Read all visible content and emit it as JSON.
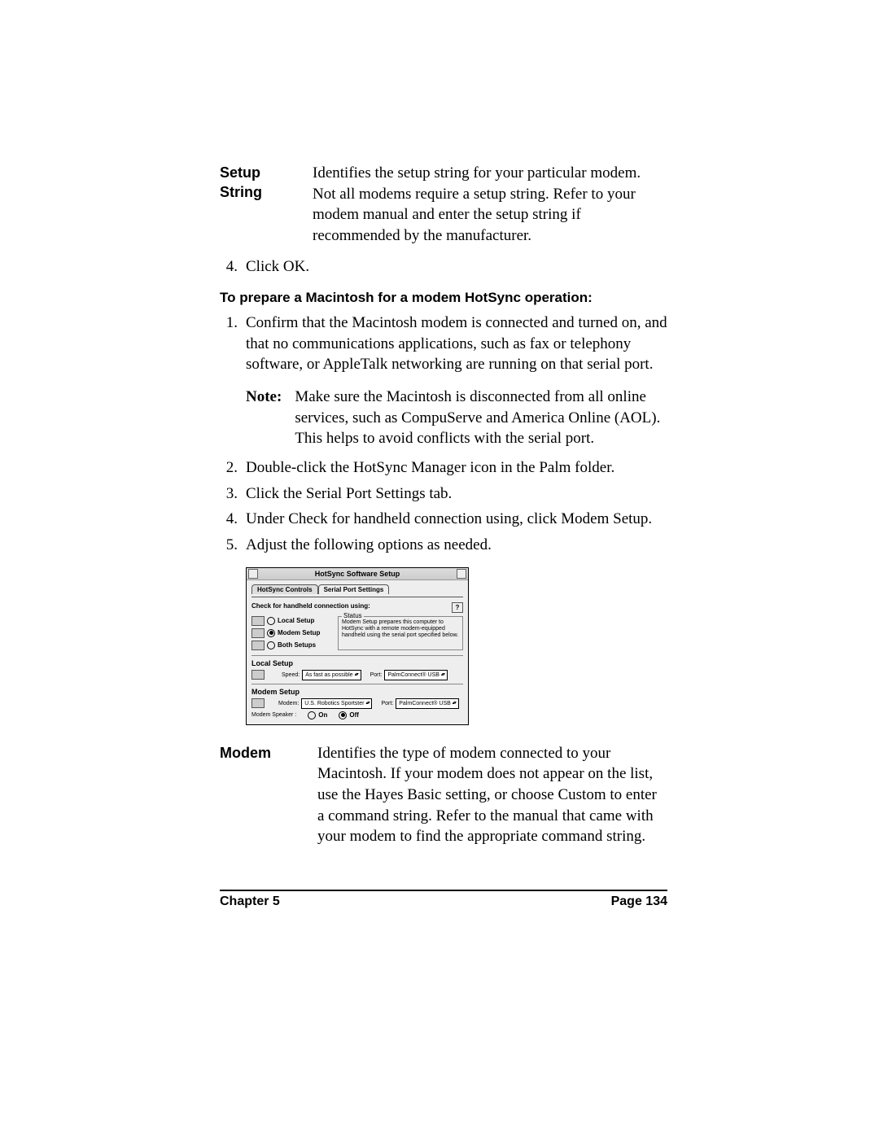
{
  "definitions": {
    "setup_string": {
      "term": "Setup String",
      "body": "Identifies the setup string for your particular modem. Not all modems require a setup string. Refer to your modem manual and enter the setup string if recommended by the manufacturer."
    },
    "modem": {
      "term": "Modem",
      "body": "Identifies the type of modem connected to your Macintosh. If your modem does not appear on the list, use the Hayes Basic setting, or choose Custom to enter a command string. Refer to the manual that came with your modem to find the appropriate command string."
    }
  },
  "step4": {
    "num": "4.",
    "text": "Click OK."
  },
  "subheading": "To prepare a Macintosh for a modem HotSync operation:",
  "steps": [
    {
      "num": "1.",
      "text": "Confirm that the Macintosh modem is connected and turned on, and that no communications applications, such as fax or telephony software, or AppleTalk networking are running on that serial port."
    },
    {
      "num": "2.",
      "text": "Double-click the HotSync Manager icon in the Palm folder."
    },
    {
      "num": "3.",
      "text": "Click the Serial Port Settings tab."
    },
    {
      "num": "4.",
      "text": "Under Check for handheld connection using, click Modem Setup."
    },
    {
      "num": "5.",
      "text": "Adjust the following options as needed."
    }
  ],
  "note": {
    "label": "Note:",
    "body": "Make sure the Macintosh is disconnected from all online services, such as CompuServe and America Online (AOL). This helps to avoid conflicts with the serial port."
  },
  "screenshot": {
    "title": "HotSync Software Setup",
    "tabs": [
      "HotSync Controls",
      "Serial Port Settings"
    ],
    "check_label": "Check for handheld connection using:",
    "help": "?",
    "radios": [
      "Local Setup",
      "Modem Setup",
      "Both Setups"
    ],
    "selected_radio": "Modem Setup",
    "status": {
      "legend": "Status",
      "text": "Modem Setup prepares this computer to HotSync with a remote modem-equipped handheld using the serial port specified below."
    },
    "local": {
      "title": "Local Setup",
      "speed_label": "Speed:",
      "speed_value": "As fast as possible",
      "port_label": "Port:",
      "port_value": "PalmConnect® USB"
    },
    "modem": {
      "title": "Modem Setup",
      "modem_label": "Modem:",
      "modem_value": "U.S. Robotics Sportster",
      "port_label": "Port:",
      "port_value": "PalmConnect® USB",
      "speaker_label": "Modem Speaker :",
      "on": "On",
      "off": "Off"
    }
  },
  "footer": {
    "left": "Chapter 5",
    "right": "Page 134"
  }
}
